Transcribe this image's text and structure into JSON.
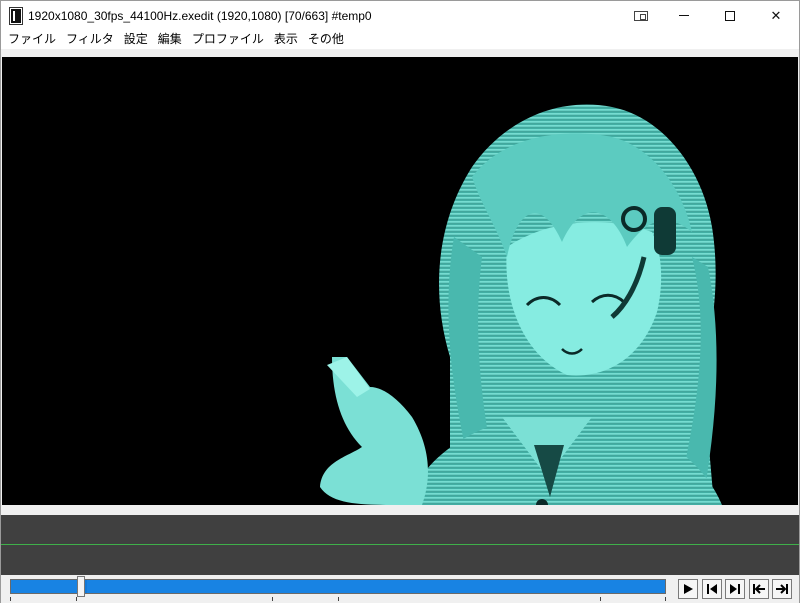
{
  "window": {
    "title": "1920x1080_30fps_44100Hz.exedit (1920,1080)  [70/663]  #temp0"
  },
  "title_controls": {
    "minimize_symbol": "—",
    "maximize_symbol": "☐",
    "close_symbol": "✕"
  },
  "menu": {
    "items": [
      "ファイル",
      "フィルタ",
      "設定",
      "編集",
      "プロファイル",
      "表示",
      "その他"
    ]
  },
  "preview": {
    "background": "#000000",
    "image_tint": "#5fd1c6"
  },
  "seek": {
    "current_frame": 70,
    "total_frames": 663,
    "accent": "#1883e3"
  },
  "playback": {
    "buttons": [
      "play-icon",
      "step-back-icon",
      "step-forward-icon",
      "go-start-icon",
      "go-end-icon"
    ]
  },
  "colors": {
    "timeline_bg": "#404040",
    "timeline_line": "#3fb04a"
  }
}
